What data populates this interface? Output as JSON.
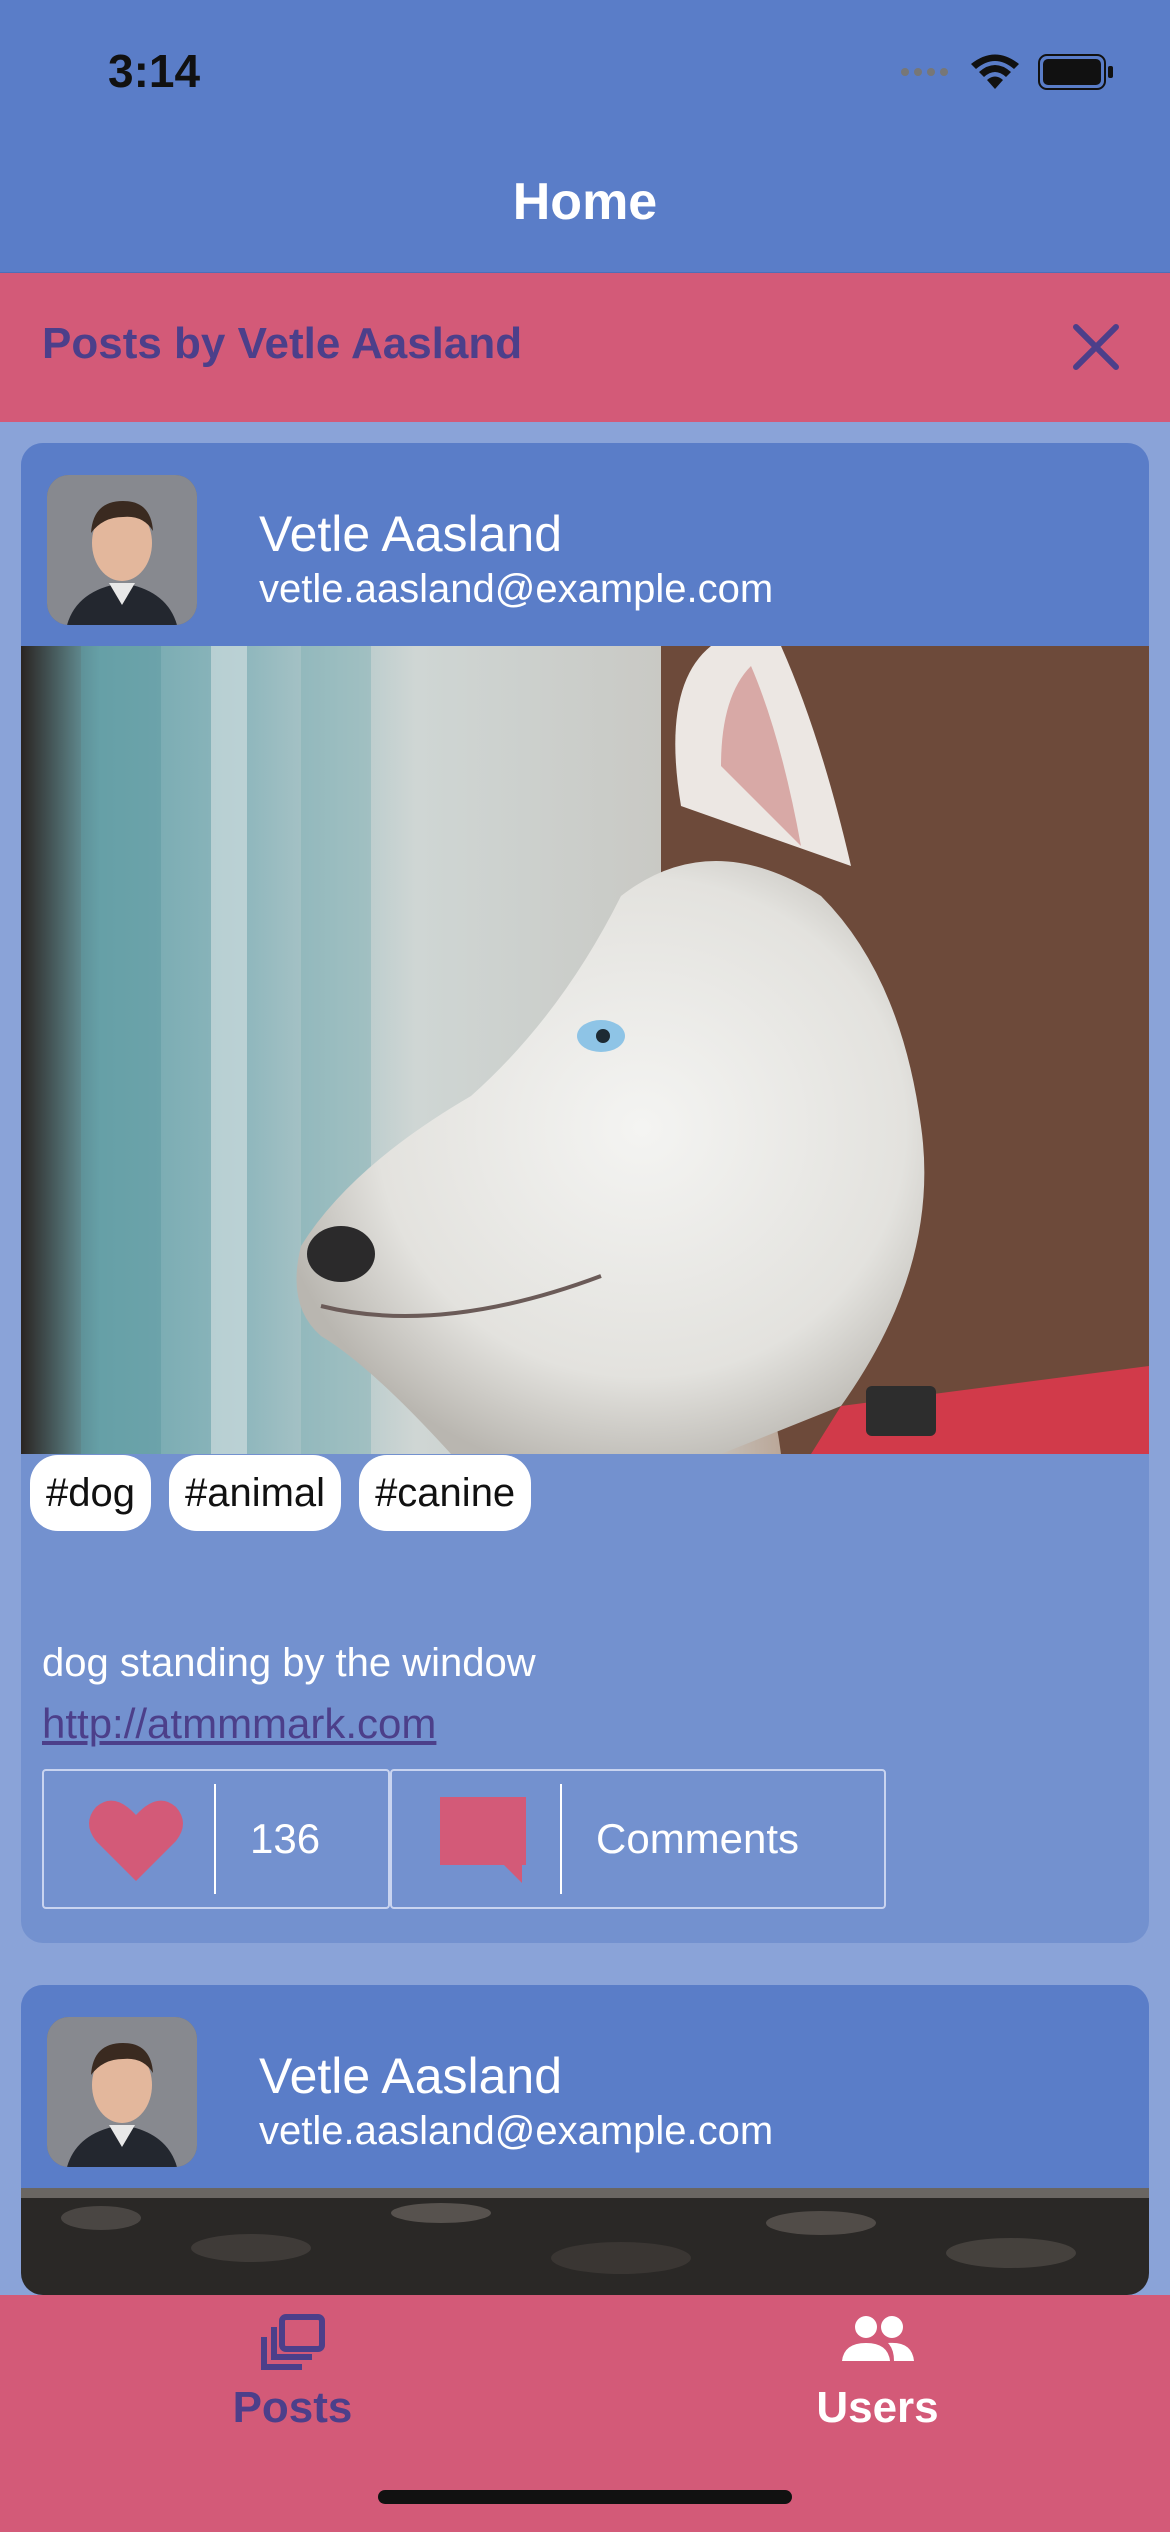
{
  "status_bar": {
    "time": "3:14"
  },
  "nav": {
    "title": "Home"
  },
  "filter_banner": {
    "text": "Posts by Vetle Aasland"
  },
  "posts": [
    {
      "author_name": "Vetle Aasland",
      "author_email": "vetle.aasland@example.com",
      "tags": [
        "#dog",
        "#animal",
        "#canine"
      ],
      "text": "dog standing by the window",
      "link": "http://atmmmark.com",
      "likes": "136",
      "comments_label": "Comments"
    },
    {
      "author_name": "Vetle Aasland",
      "author_email": "vetle.aasland@example.com"
    }
  ],
  "tab_bar": {
    "tabs": [
      {
        "label": "Posts",
        "icon": "posts-icon",
        "active": true
      },
      {
        "label": "Users",
        "icon": "users-icon",
        "active": false
      }
    ]
  },
  "colors": {
    "header_blue": "#5a7dc8",
    "accent_pink": "#d35a78",
    "active_tab_purple": "#4c3f8a"
  }
}
